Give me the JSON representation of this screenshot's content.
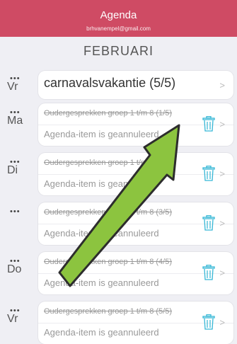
{
  "header": {
    "title": "Agenda",
    "email": "brhvanempel@gmail.com"
  },
  "month": "FEBRUARI",
  "rows": [
    {
      "day": "Vr",
      "dots": "•••",
      "type": "single",
      "title": "carnavalsvakantie (5/5)"
    },
    {
      "day": "Ma",
      "dots": "•••",
      "type": "cancelled",
      "title": "Oudergesprekken groep 1 t/m 8 (1/5)",
      "status": "Agenda-item is geannuleerd"
    },
    {
      "day": "Di",
      "dots": "•••",
      "type": "cancelled",
      "title": "Oudergesprekken groep 1 t/m 8 (2/5)",
      "status": "Agenda-item is geannuleerd"
    },
    {
      "day": "",
      "dots": "•••",
      "type": "cancelled",
      "title": "Oudergesprekken groep 1 t/m 8 (3/5)",
      "status": "Agenda-item is geannuleerd"
    },
    {
      "day": "Do",
      "dots": "•••",
      "type": "cancelled",
      "title": "Oudergesprekken groep 1 t/m 8 (4/5)",
      "status": "Agenda-item is geannuleerd"
    },
    {
      "day": "Vr",
      "dots": "•••",
      "type": "cancelled",
      "title": "Oudergesprekken groep 1 t/m 8 (5/5)",
      "status": "Agenda-item is geannuleerd"
    }
  ],
  "icons": {
    "delete": "trash-icon",
    "chevron": "chevron-right-icon",
    "annotation": "arrow-annotation"
  },
  "colors": {
    "header": "#cf4b64",
    "trash": "#35b7d6",
    "arrow": "#8cc43f"
  }
}
